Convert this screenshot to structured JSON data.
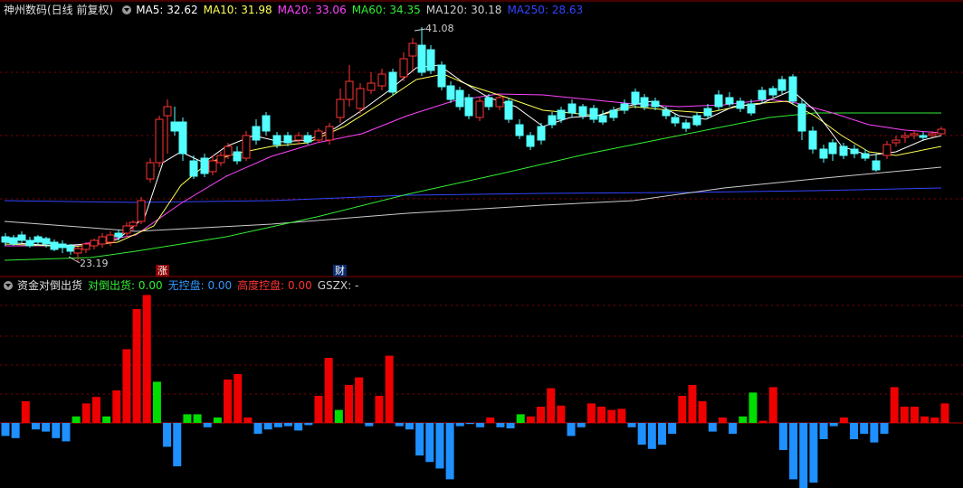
{
  "main_panel": {
    "stock_name": "神州数码(日线 前复权)",
    "indicators": [
      {
        "label": "MA5: 32.62",
        "color": "#ffffff"
      },
      {
        "label": "MA10: 31.98",
        "color": "#ffff55"
      },
      {
        "label": "MA20: 33.06",
        "color": "#ff44ff"
      },
      {
        "label": "MA60: 34.35",
        "color": "#33ee33"
      },
      {
        "label": "MA120: 30.18",
        "color": "#cccccc"
      },
      {
        "label": "MA250: 28.63",
        "color": "#3344ff"
      }
    ],
    "high_label": "41.08",
    "low_label": "23.19",
    "marker_zhang": "涨",
    "marker_cai": "财"
  },
  "sub_panel": {
    "title": "资金对倒出货",
    "indicators": [
      {
        "label": "对倒出货: 0.00",
        "color": "#33ee33"
      },
      {
        "label": "无控盘: 0.00",
        "color": "#3399ff"
      },
      {
        "label": "高度控盘: 0.00",
        "color": "#ff3333"
      },
      {
        "label": "GSZX: -",
        "color": "#cccccc"
      }
    ]
  },
  "colors": {
    "up": "#ff3333",
    "down": "#54ffff",
    "grid": "#8b0000",
    "bar_red": "#ee0000",
    "bar_blue": "#1e90ff",
    "bar_green": "#00dd00"
  },
  "chart_data": {
    "type": "candlestick",
    "price_range": [
      23.19,
      41.08
    ],
    "volume_bars": [
      -12,
      -14,
      20,
      -6,
      -8,
      -14,
      -17,
      6,
      18,
      24,
      6,
      30,
      68,
      105,
      118,
      38,
      -22,
      -40,
      8,
      8,
      -4,
      5,
      40,
      45,
      5,
      -10,
      -6,
      -4,
      -3,
      -7,
      -2,
      25,
      60,
      12,
      35,
      42,
      -3,
      25,
      62,
      -3,
      -6,
      -30,
      -36,
      -42,
      -52,
      -3,
      -1,
      -4,
      5,
      -4,
      -5,
      8,
      6,
      15,
      32,
      16,
      -12,
      -4,
      18,
      15,
      12,
      13,
      -4,
      -20,
      -24,
      -20,
      -10,
      25,
      35,
      20,
      -8,
      5,
      -10,
      6,
      28,
      2,
      33,
      -25,
      -52,
      -68,
      -55,
      -15,
      -3,
      5,
      -15,
      -10,
      -18,
      -10,
      33,
      15,
      15,
      6,
      5,
      18
    ]
  }
}
